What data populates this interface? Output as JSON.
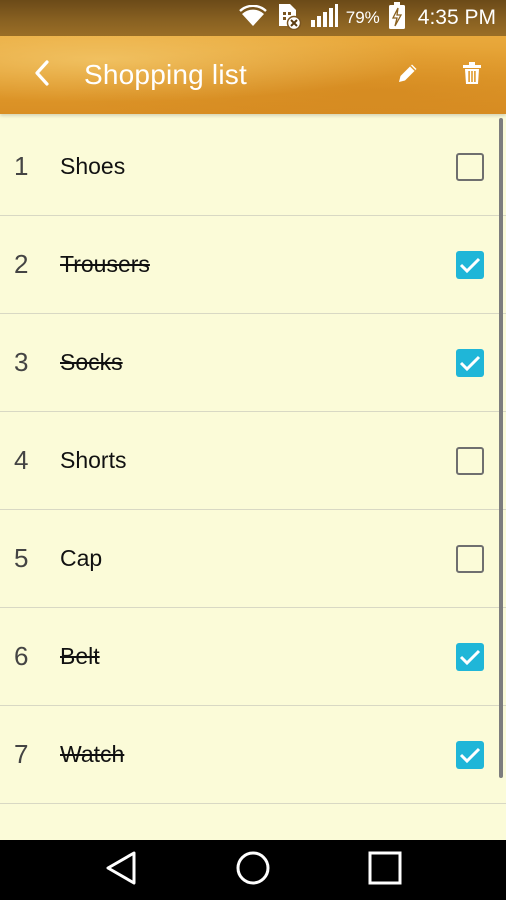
{
  "status_bar": {
    "battery": "79%",
    "time": "4:35 PM",
    "icons": [
      "wifi-icon",
      "sim-error-icon",
      "signal-icon",
      "battery-charging-icon"
    ]
  },
  "app_bar": {
    "title": "Shopping list",
    "icons": [
      "back-arrow-icon",
      "edit-pencil-icon",
      "trash-icon"
    ]
  },
  "list": {
    "items": [
      {
        "number": "1",
        "label": "Shoes",
        "checked": false
      },
      {
        "number": "2",
        "label": "Trousers",
        "checked": true
      },
      {
        "number": "3",
        "label": "Socks",
        "checked": true
      },
      {
        "number": "4",
        "label": "Shorts",
        "checked": false
      },
      {
        "number": "5",
        "label": "Cap",
        "checked": false
      },
      {
        "number": "6",
        "label": "Belt",
        "checked": true
      },
      {
        "number": "7",
        "label": "Watch",
        "checked": true
      }
    ]
  },
  "nav_bar": {
    "icons": [
      "back-triangle-icon",
      "home-circle-icon",
      "recents-square-icon"
    ]
  },
  "colors": {
    "app_bar": "#e09a2c",
    "background": "#fbfbd8",
    "checkbox_checked": "#1fb6d8",
    "nav_bar": "#000000"
  }
}
